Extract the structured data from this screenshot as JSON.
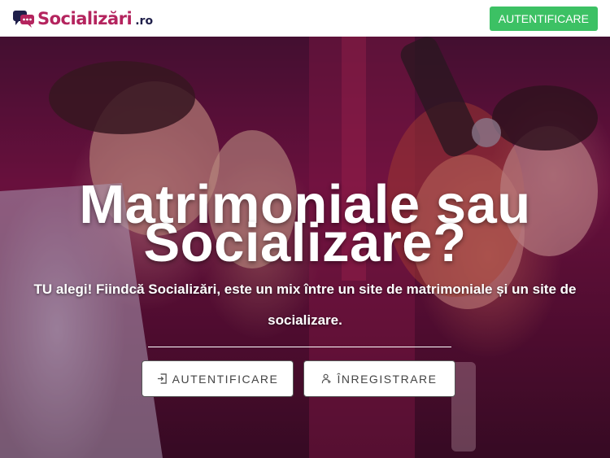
{
  "header": {
    "logo_text": "Socializări",
    "logo_tld": ".ro",
    "login_button": "AUTENTIFICARE"
  },
  "hero": {
    "title_line1": "Matrimoniale sau",
    "title_line2": "Socializare?",
    "subtitle": "TU alegi! Fiindcă Socializări, este un mix între un site de matrimoniale și un site de socializare.",
    "login_button": "AUTENTIFICARE",
    "register_button": "ÎNREGISTRARE"
  },
  "icons": {
    "logo": "chat-bubbles-icon",
    "login": "sign-in-icon",
    "register": "user-plus-icon"
  },
  "colors": {
    "brand": "#b4245e",
    "brand_dark": "#1f1f4a",
    "login_green": "#3cc164",
    "hero_tint": "#6d1240"
  }
}
